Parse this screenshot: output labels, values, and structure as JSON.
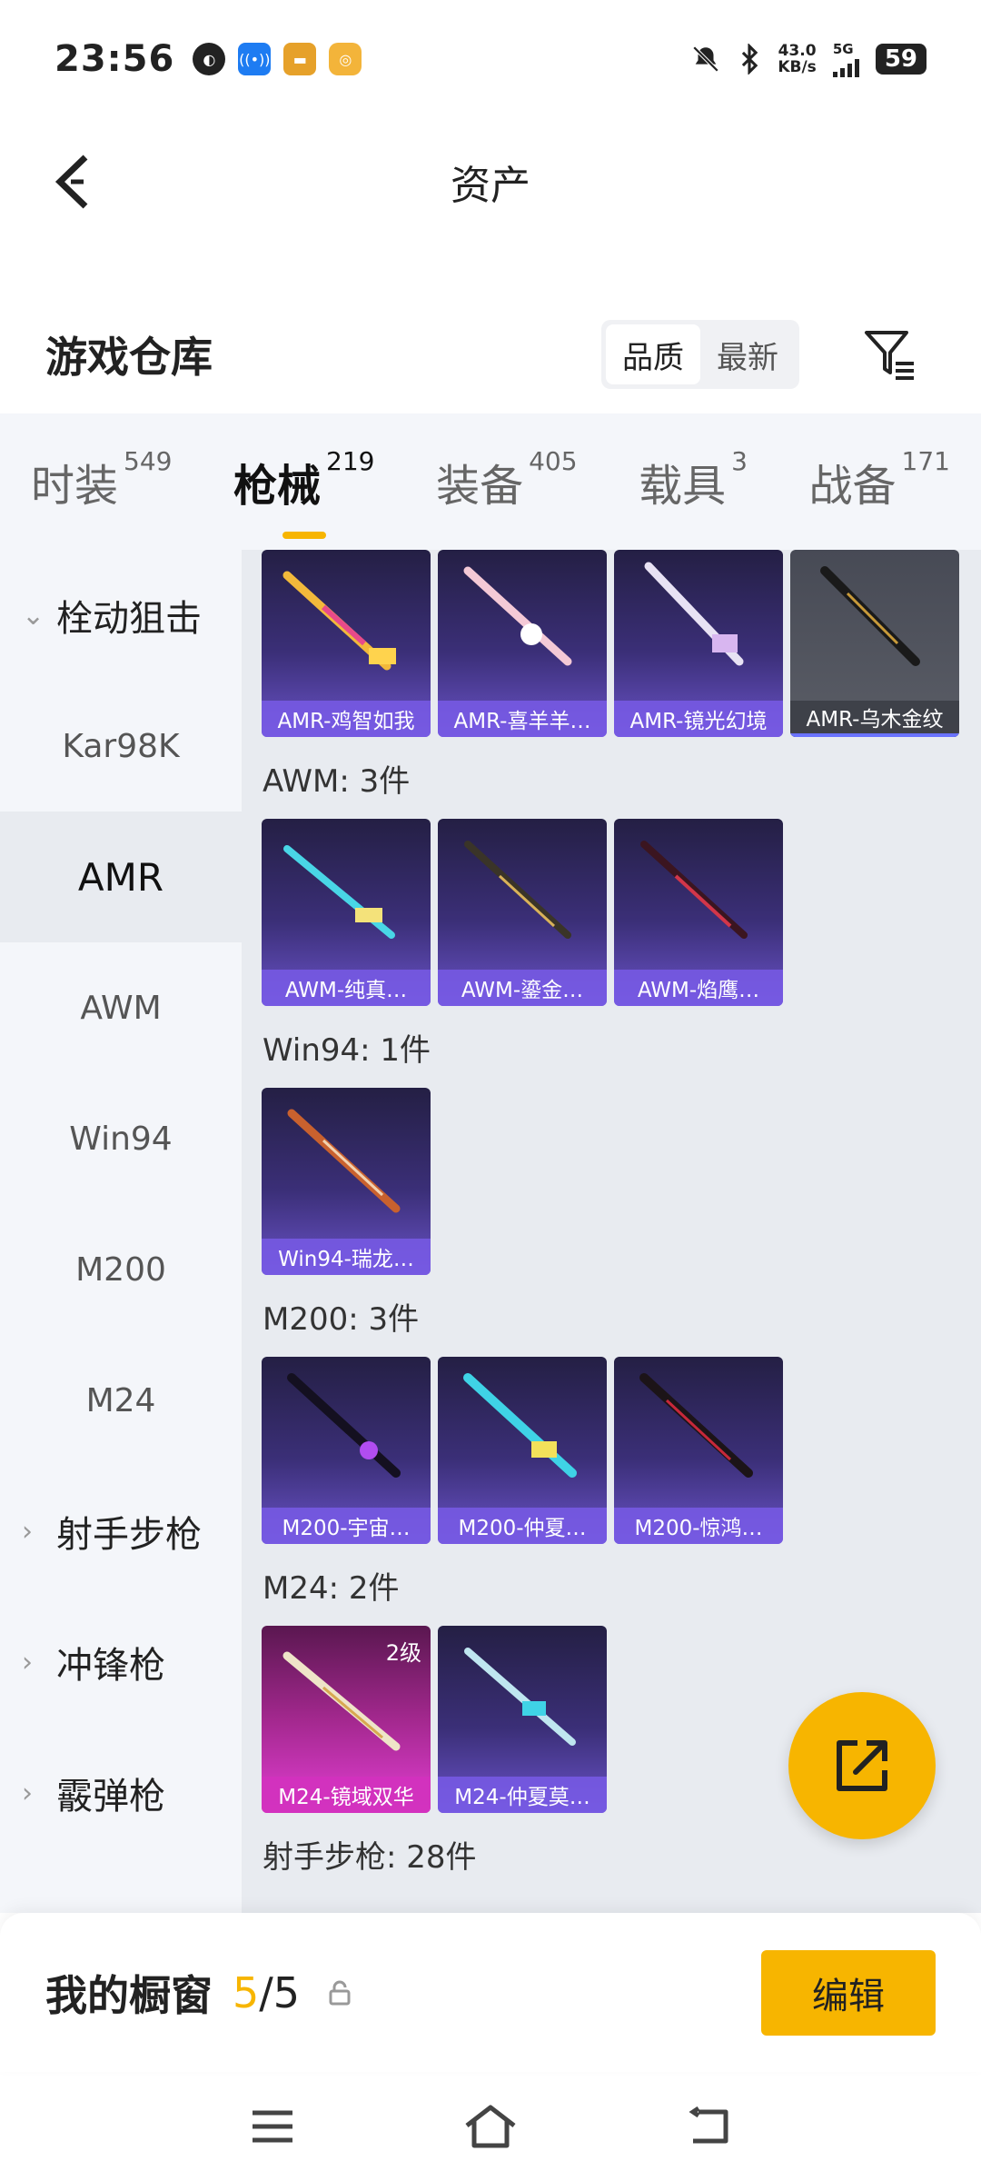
{
  "status_bar": {
    "time": "23:56",
    "net_speed_value": "43.0",
    "net_speed_unit": "KB/s",
    "network": "5G",
    "battery": "59"
  },
  "header": {
    "title": "资产"
  },
  "warehouse": {
    "title": "游戏仓库",
    "sort_options": [
      "品质",
      "最新"
    ],
    "active_sort": "品质"
  },
  "category_tabs": [
    {
      "name": "时装",
      "count": "549"
    },
    {
      "name": "枪械",
      "count": "219"
    },
    {
      "name": "装备",
      "count": "405"
    },
    {
      "name": "载具",
      "count": "3"
    },
    {
      "name": "战备",
      "count": "171"
    }
  ],
  "sidebar": {
    "items": [
      {
        "label": "栓动狙击",
        "type": "group",
        "chevron": "⌄"
      },
      {
        "label": "Kar98K",
        "type": "item"
      },
      {
        "label": "AMR",
        "type": "item",
        "active": true
      },
      {
        "label": "AWM",
        "type": "item"
      },
      {
        "label": "Win94",
        "type": "item"
      },
      {
        "label": "M200",
        "type": "item"
      },
      {
        "label": "M24",
        "type": "item"
      },
      {
        "label": "射手步枪",
        "type": "group",
        "chevron": "›"
      },
      {
        "label": "冲锋枪",
        "type": "group",
        "chevron": "›"
      },
      {
        "label": "霰弹枪",
        "type": "group",
        "chevron": "›"
      }
    ]
  },
  "sections": {
    "amr": {
      "items": [
        "AMR-鸡智如我",
        "AMR-喜羊羊…",
        "AMR-镜光幻境",
        "AMR-乌木金纹"
      ]
    },
    "awm": {
      "label": "AWM: 3件",
      "items": [
        "AWM-纯真…",
        "AWM-鎏金…",
        "AWM-焰鹰…"
      ]
    },
    "win94": {
      "label": "Win94: 1件",
      "items": [
        "Win94-瑞龙…"
      ]
    },
    "m200": {
      "label": "M200: 3件",
      "items": [
        "M200-宇宙…",
        "M200-仲夏…",
        "M200-惊鸿…"
      ]
    },
    "m24": {
      "label": "M24: 2件",
      "items": [
        "M24-镜域双华",
        "M24-仲夏莫…"
      ],
      "level_badge": "2级"
    },
    "marksman": {
      "label": "射手步枪: 28件"
    }
  },
  "showcase": {
    "title": "我的橱窗",
    "current": "5",
    "separator_total": "/5",
    "edit_label": "编辑"
  },
  "colors": {
    "accent": "#f7b500",
    "tile_label": "#785ae6",
    "sidebar_bg": "#f4f6fa",
    "content_bg": "#e8ebf0"
  },
  "icons": {
    "back": "back-arrow-icon",
    "filter": "filter-icon",
    "share": "share-icon",
    "lock": "lock-icon"
  }
}
